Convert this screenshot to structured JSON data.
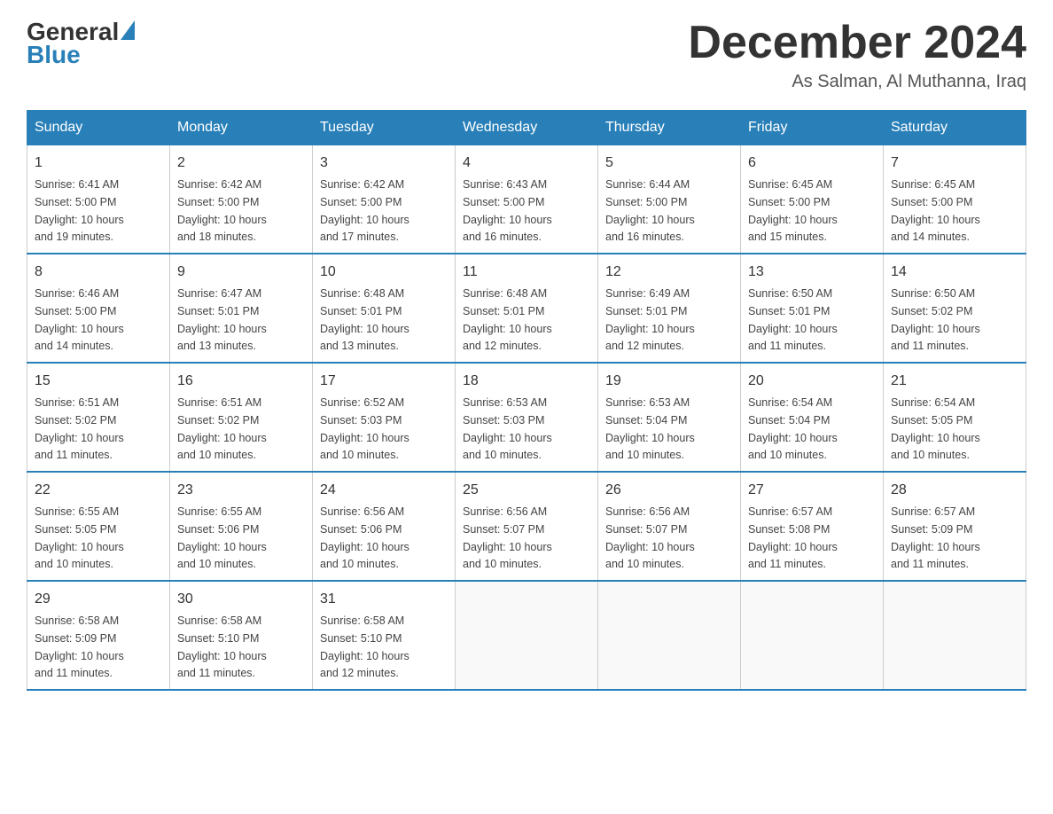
{
  "logo": {
    "general": "General",
    "blue": "Blue",
    "subtitle": "Blue"
  },
  "title": "December 2024",
  "location": "As Salman, Al Muthanna, Iraq",
  "days_of_week": [
    "Sunday",
    "Monday",
    "Tuesday",
    "Wednesday",
    "Thursday",
    "Friday",
    "Saturday"
  ],
  "weeks": [
    [
      {
        "day": "1",
        "sunrise": "6:41 AM",
        "sunset": "5:00 PM",
        "daylight": "10 hours and 19 minutes."
      },
      {
        "day": "2",
        "sunrise": "6:42 AM",
        "sunset": "5:00 PM",
        "daylight": "10 hours and 18 minutes."
      },
      {
        "day": "3",
        "sunrise": "6:42 AM",
        "sunset": "5:00 PM",
        "daylight": "10 hours and 17 minutes."
      },
      {
        "day": "4",
        "sunrise": "6:43 AM",
        "sunset": "5:00 PM",
        "daylight": "10 hours and 16 minutes."
      },
      {
        "day": "5",
        "sunrise": "6:44 AM",
        "sunset": "5:00 PM",
        "daylight": "10 hours and 16 minutes."
      },
      {
        "day": "6",
        "sunrise": "6:45 AM",
        "sunset": "5:00 PM",
        "daylight": "10 hours and 15 minutes."
      },
      {
        "day": "7",
        "sunrise": "6:45 AM",
        "sunset": "5:00 PM",
        "daylight": "10 hours and 14 minutes."
      }
    ],
    [
      {
        "day": "8",
        "sunrise": "6:46 AM",
        "sunset": "5:00 PM",
        "daylight": "10 hours and 14 minutes."
      },
      {
        "day": "9",
        "sunrise": "6:47 AM",
        "sunset": "5:01 PM",
        "daylight": "10 hours and 13 minutes."
      },
      {
        "day": "10",
        "sunrise": "6:48 AM",
        "sunset": "5:01 PM",
        "daylight": "10 hours and 13 minutes."
      },
      {
        "day": "11",
        "sunrise": "6:48 AM",
        "sunset": "5:01 PM",
        "daylight": "10 hours and 12 minutes."
      },
      {
        "day": "12",
        "sunrise": "6:49 AM",
        "sunset": "5:01 PM",
        "daylight": "10 hours and 12 minutes."
      },
      {
        "day": "13",
        "sunrise": "6:50 AM",
        "sunset": "5:01 PM",
        "daylight": "10 hours and 11 minutes."
      },
      {
        "day": "14",
        "sunrise": "6:50 AM",
        "sunset": "5:02 PM",
        "daylight": "10 hours and 11 minutes."
      }
    ],
    [
      {
        "day": "15",
        "sunrise": "6:51 AM",
        "sunset": "5:02 PM",
        "daylight": "10 hours and 11 minutes."
      },
      {
        "day": "16",
        "sunrise": "6:51 AM",
        "sunset": "5:02 PM",
        "daylight": "10 hours and 10 minutes."
      },
      {
        "day": "17",
        "sunrise": "6:52 AM",
        "sunset": "5:03 PM",
        "daylight": "10 hours and 10 minutes."
      },
      {
        "day": "18",
        "sunrise": "6:53 AM",
        "sunset": "5:03 PM",
        "daylight": "10 hours and 10 minutes."
      },
      {
        "day": "19",
        "sunrise": "6:53 AM",
        "sunset": "5:04 PM",
        "daylight": "10 hours and 10 minutes."
      },
      {
        "day": "20",
        "sunrise": "6:54 AM",
        "sunset": "5:04 PM",
        "daylight": "10 hours and 10 minutes."
      },
      {
        "day": "21",
        "sunrise": "6:54 AM",
        "sunset": "5:05 PM",
        "daylight": "10 hours and 10 minutes."
      }
    ],
    [
      {
        "day": "22",
        "sunrise": "6:55 AM",
        "sunset": "5:05 PM",
        "daylight": "10 hours and 10 minutes."
      },
      {
        "day": "23",
        "sunrise": "6:55 AM",
        "sunset": "5:06 PM",
        "daylight": "10 hours and 10 minutes."
      },
      {
        "day": "24",
        "sunrise": "6:56 AM",
        "sunset": "5:06 PM",
        "daylight": "10 hours and 10 minutes."
      },
      {
        "day": "25",
        "sunrise": "6:56 AM",
        "sunset": "5:07 PM",
        "daylight": "10 hours and 10 minutes."
      },
      {
        "day": "26",
        "sunrise": "6:56 AM",
        "sunset": "5:07 PM",
        "daylight": "10 hours and 10 minutes."
      },
      {
        "day": "27",
        "sunrise": "6:57 AM",
        "sunset": "5:08 PM",
        "daylight": "10 hours and 11 minutes."
      },
      {
        "day": "28",
        "sunrise": "6:57 AM",
        "sunset": "5:09 PM",
        "daylight": "10 hours and 11 minutes."
      }
    ],
    [
      {
        "day": "29",
        "sunrise": "6:58 AM",
        "sunset": "5:09 PM",
        "daylight": "10 hours and 11 minutes."
      },
      {
        "day": "30",
        "sunrise": "6:58 AM",
        "sunset": "5:10 PM",
        "daylight": "10 hours and 11 minutes."
      },
      {
        "day": "31",
        "sunrise": "6:58 AM",
        "sunset": "5:10 PM",
        "daylight": "10 hours and 12 minutes."
      },
      null,
      null,
      null,
      null
    ]
  ],
  "labels": {
    "sunrise": "Sunrise:",
    "sunset": "Sunset:",
    "daylight": "Daylight:"
  }
}
